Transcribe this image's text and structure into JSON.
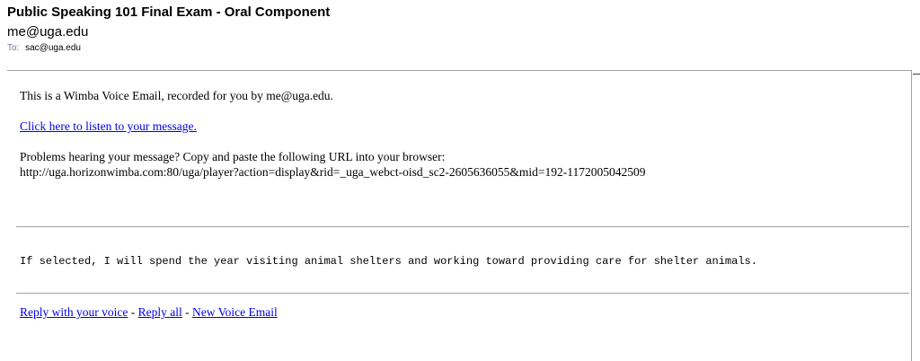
{
  "email": {
    "subject": "Public Speaking 101 Final Exam - Oral Component",
    "from": "me@uga.edu",
    "to_label": "To:",
    "to": "sac@uga.edu"
  },
  "body": {
    "intro": "This is a Wimba Voice Email, recorded for you by me@uga.edu.",
    "listen_link": "Click here to listen to your message.",
    "problems": "Problems hearing your message? Copy and paste the following URL into your browser:",
    "url": "http://uga.horizonwimba.com:80/uga/player?action=display&rid=_uga_webct-oisd_sc2-2605636055&mid=192-1172005042509",
    "transcript": "If selected, I will spend the year visiting animal shelters and working toward providing care for shelter animals."
  },
  "footer": {
    "reply_voice": "Reply with your voice",
    "separator": " - ",
    "reply_all": "Reply all",
    "new_voice_email": "New Voice Email"
  },
  "colors": {
    "link": "#0000ee",
    "rule": "#a0a0a0",
    "to_label": "#6b7b9e"
  }
}
